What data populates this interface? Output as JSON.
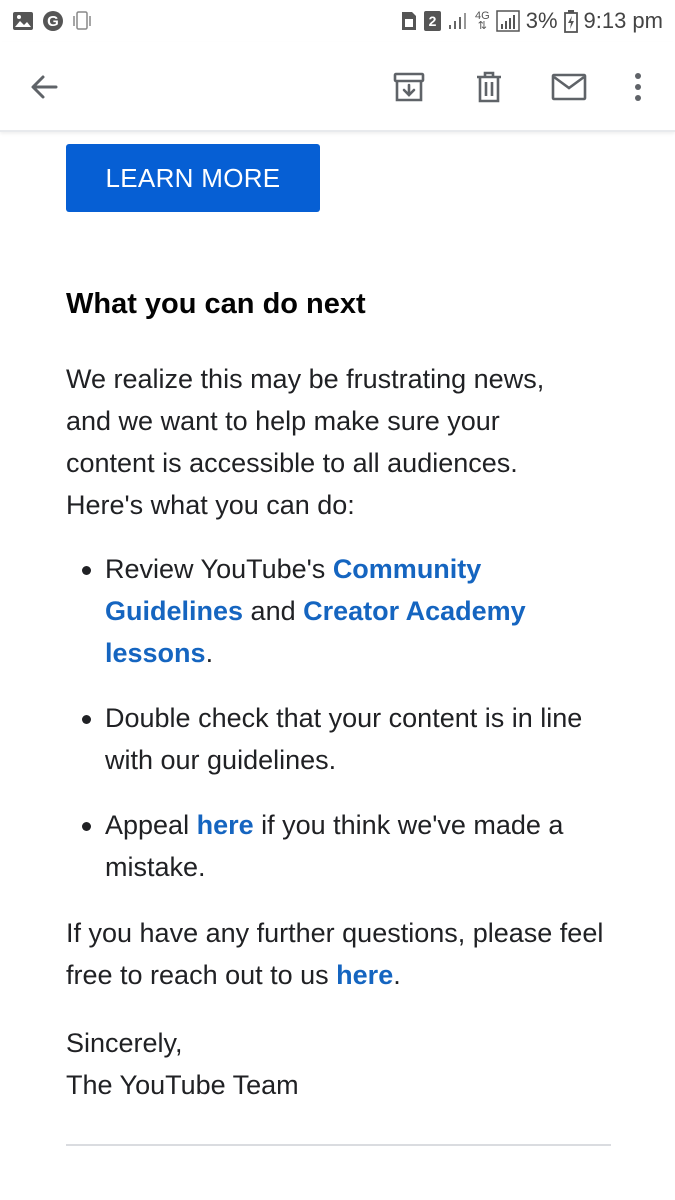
{
  "status_bar": {
    "sim_number": "2",
    "network_type": "4G",
    "battery": "3%",
    "time": "9:13 pm",
    "icons": [
      "gallery-icon",
      "google-icon",
      "vibrate-icon",
      "sim-icon",
      "signal-icon",
      "battery-icon"
    ]
  },
  "app_bar": {
    "icons": [
      "back-arrow-icon",
      "archive-icon",
      "delete-icon",
      "mail-icon",
      "more-vert-icon"
    ]
  },
  "email": {
    "learn_more_label": "LEARN MORE",
    "heading": "What you can do next",
    "intro": "We realize this may be frustrating news, and we want to help make sure your content is accessible to all audiences. Here's what you can do:",
    "bullet1": {
      "pre": "Review YouTube's ",
      "link1": "Community Guidelines",
      "mid": " and ",
      "link2": "Creator Academy lessons",
      "post": "."
    },
    "bullet2": {
      "text": "Double check that your content is in line with our guidelines."
    },
    "bullet3": {
      "pre": "Appeal ",
      "link": "here",
      "post": " if you think we've made a mistake."
    },
    "questions": {
      "pre": "If you have any further questions, please feel free to reach out to us ",
      "link": "here",
      "post": "."
    },
    "signoff": "Sincerely,",
    "signature": "The YouTube Team"
  },
  "colors": {
    "button_blue": "#065fd4",
    "link_blue": "#1565c0",
    "text": "#202124"
  }
}
